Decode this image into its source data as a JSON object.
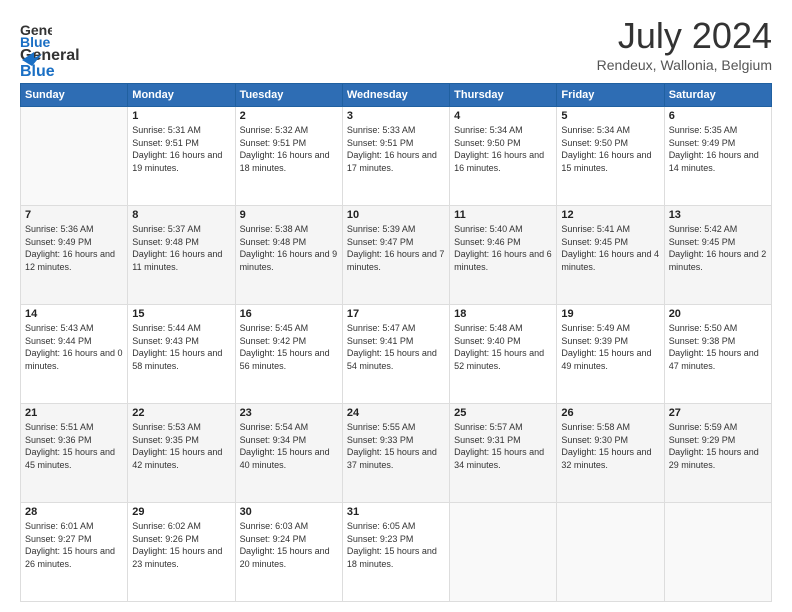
{
  "logo": {
    "general": "General",
    "blue": "Blue"
  },
  "header": {
    "month_year": "July 2024",
    "location": "Rendeux, Wallonia, Belgium"
  },
  "weekdays": [
    "Sunday",
    "Monday",
    "Tuesday",
    "Wednesday",
    "Thursday",
    "Friday",
    "Saturday"
  ],
  "weeks": [
    [
      {
        "day": "",
        "sunrise": "",
        "sunset": "",
        "daylight": ""
      },
      {
        "day": "1",
        "sunrise": "Sunrise: 5:31 AM",
        "sunset": "Sunset: 9:51 PM",
        "daylight": "Daylight: 16 hours and 19 minutes."
      },
      {
        "day": "2",
        "sunrise": "Sunrise: 5:32 AM",
        "sunset": "Sunset: 9:51 PM",
        "daylight": "Daylight: 16 hours and 18 minutes."
      },
      {
        "day": "3",
        "sunrise": "Sunrise: 5:33 AM",
        "sunset": "Sunset: 9:51 PM",
        "daylight": "Daylight: 16 hours and 17 minutes."
      },
      {
        "day": "4",
        "sunrise": "Sunrise: 5:34 AM",
        "sunset": "Sunset: 9:50 PM",
        "daylight": "Daylight: 16 hours and 16 minutes."
      },
      {
        "day": "5",
        "sunrise": "Sunrise: 5:34 AM",
        "sunset": "Sunset: 9:50 PM",
        "daylight": "Daylight: 16 hours and 15 minutes."
      },
      {
        "day": "6",
        "sunrise": "Sunrise: 5:35 AM",
        "sunset": "Sunset: 9:49 PM",
        "daylight": "Daylight: 16 hours and 14 minutes."
      }
    ],
    [
      {
        "day": "7",
        "sunrise": "Sunrise: 5:36 AM",
        "sunset": "Sunset: 9:49 PM",
        "daylight": "Daylight: 16 hours and 12 minutes."
      },
      {
        "day": "8",
        "sunrise": "Sunrise: 5:37 AM",
        "sunset": "Sunset: 9:48 PM",
        "daylight": "Daylight: 16 hours and 11 minutes."
      },
      {
        "day": "9",
        "sunrise": "Sunrise: 5:38 AM",
        "sunset": "Sunset: 9:48 PM",
        "daylight": "Daylight: 16 hours and 9 minutes."
      },
      {
        "day": "10",
        "sunrise": "Sunrise: 5:39 AM",
        "sunset": "Sunset: 9:47 PM",
        "daylight": "Daylight: 16 hours and 7 minutes."
      },
      {
        "day": "11",
        "sunrise": "Sunrise: 5:40 AM",
        "sunset": "Sunset: 9:46 PM",
        "daylight": "Daylight: 16 hours and 6 minutes."
      },
      {
        "day": "12",
        "sunrise": "Sunrise: 5:41 AM",
        "sunset": "Sunset: 9:45 PM",
        "daylight": "Daylight: 16 hours and 4 minutes."
      },
      {
        "day": "13",
        "sunrise": "Sunrise: 5:42 AM",
        "sunset": "Sunset: 9:45 PM",
        "daylight": "Daylight: 16 hours and 2 minutes."
      }
    ],
    [
      {
        "day": "14",
        "sunrise": "Sunrise: 5:43 AM",
        "sunset": "Sunset: 9:44 PM",
        "daylight": "Daylight: 16 hours and 0 minutes."
      },
      {
        "day": "15",
        "sunrise": "Sunrise: 5:44 AM",
        "sunset": "Sunset: 9:43 PM",
        "daylight": "Daylight: 15 hours and 58 minutes."
      },
      {
        "day": "16",
        "sunrise": "Sunrise: 5:45 AM",
        "sunset": "Sunset: 9:42 PM",
        "daylight": "Daylight: 15 hours and 56 minutes."
      },
      {
        "day": "17",
        "sunrise": "Sunrise: 5:47 AM",
        "sunset": "Sunset: 9:41 PM",
        "daylight": "Daylight: 15 hours and 54 minutes."
      },
      {
        "day": "18",
        "sunrise": "Sunrise: 5:48 AM",
        "sunset": "Sunset: 9:40 PM",
        "daylight": "Daylight: 15 hours and 52 minutes."
      },
      {
        "day": "19",
        "sunrise": "Sunrise: 5:49 AM",
        "sunset": "Sunset: 9:39 PM",
        "daylight": "Daylight: 15 hours and 49 minutes."
      },
      {
        "day": "20",
        "sunrise": "Sunrise: 5:50 AM",
        "sunset": "Sunset: 9:38 PM",
        "daylight": "Daylight: 15 hours and 47 minutes."
      }
    ],
    [
      {
        "day": "21",
        "sunrise": "Sunrise: 5:51 AM",
        "sunset": "Sunset: 9:36 PM",
        "daylight": "Daylight: 15 hours and 45 minutes."
      },
      {
        "day": "22",
        "sunrise": "Sunrise: 5:53 AM",
        "sunset": "Sunset: 9:35 PM",
        "daylight": "Daylight: 15 hours and 42 minutes."
      },
      {
        "day": "23",
        "sunrise": "Sunrise: 5:54 AM",
        "sunset": "Sunset: 9:34 PM",
        "daylight": "Daylight: 15 hours and 40 minutes."
      },
      {
        "day": "24",
        "sunrise": "Sunrise: 5:55 AM",
        "sunset": "Sunset: 9:33 PM",
        "daylight": "Daylight: 15 hours and 37 minutes."
      },
      {
        "day": "25",
        "sunrise": "Sunrise: 5:57 AM",
        "sunset": "Sunset: 9:31 PM",
        "daylight": "Daylight: 15 hours and 34 minutes."
      },
      {
        "day": "26",
        "sunrise": "Sunrise: 5:58 AM",
        "sunset": "Sunset: 9:30 PM",
        "daylight": "Daylight: 15 hours and 32 minutes."
      },
      {
        "day": "27",
        "sunrise": "Sunrise: 5:59 AM",
        "sunset": "Sunset: 9:29 PM",
        "daylight": "Daylight: 15 hours and 29 minutes."
      }
    ],
    [
      {
        "day": "28",
        "sunrise": "Sunrise: 6:01 AM",
        "sunset": "Sunset: 9:27 PM",
        "daylight": "Daylight: 15 hours and 26 minutes."
      },
      {
        "day": "29",
        "sunrise": "Sunrise: 6:02 AM",
        "sunset": "Sunset: 9:26 PM",
        "daylight": "Daylight: 15 hours and 23 minutes."
      },
      {
        "day": "30",
        "sunrise": "Sunrise: 6:03 AM",
        "sunset": "Sunset: 9:24 PM",
        "daylight": "Daylight: 15 hours and 20 minutes."
      },
      {
        "day": "31",
        "sunrise": "Sunrise: 6:05 AM",
        "sunset": "Sunset: 9:23 PM",
        "daylight": "Daylight: 15 hours and 18 minutes."
      },
      {
        "day": "",
        "sunrise": "",
        "sunset": "",
        "daylight": ""
      },
      {
        "day": "",
        "sunrise": "",
        "sunset": "",
        "daylight": ""
      },
      {
        "day": "",
        "sunrise": "",
        "sunset": "",
        "daylight": ""
      }
    ]
  ]
}
